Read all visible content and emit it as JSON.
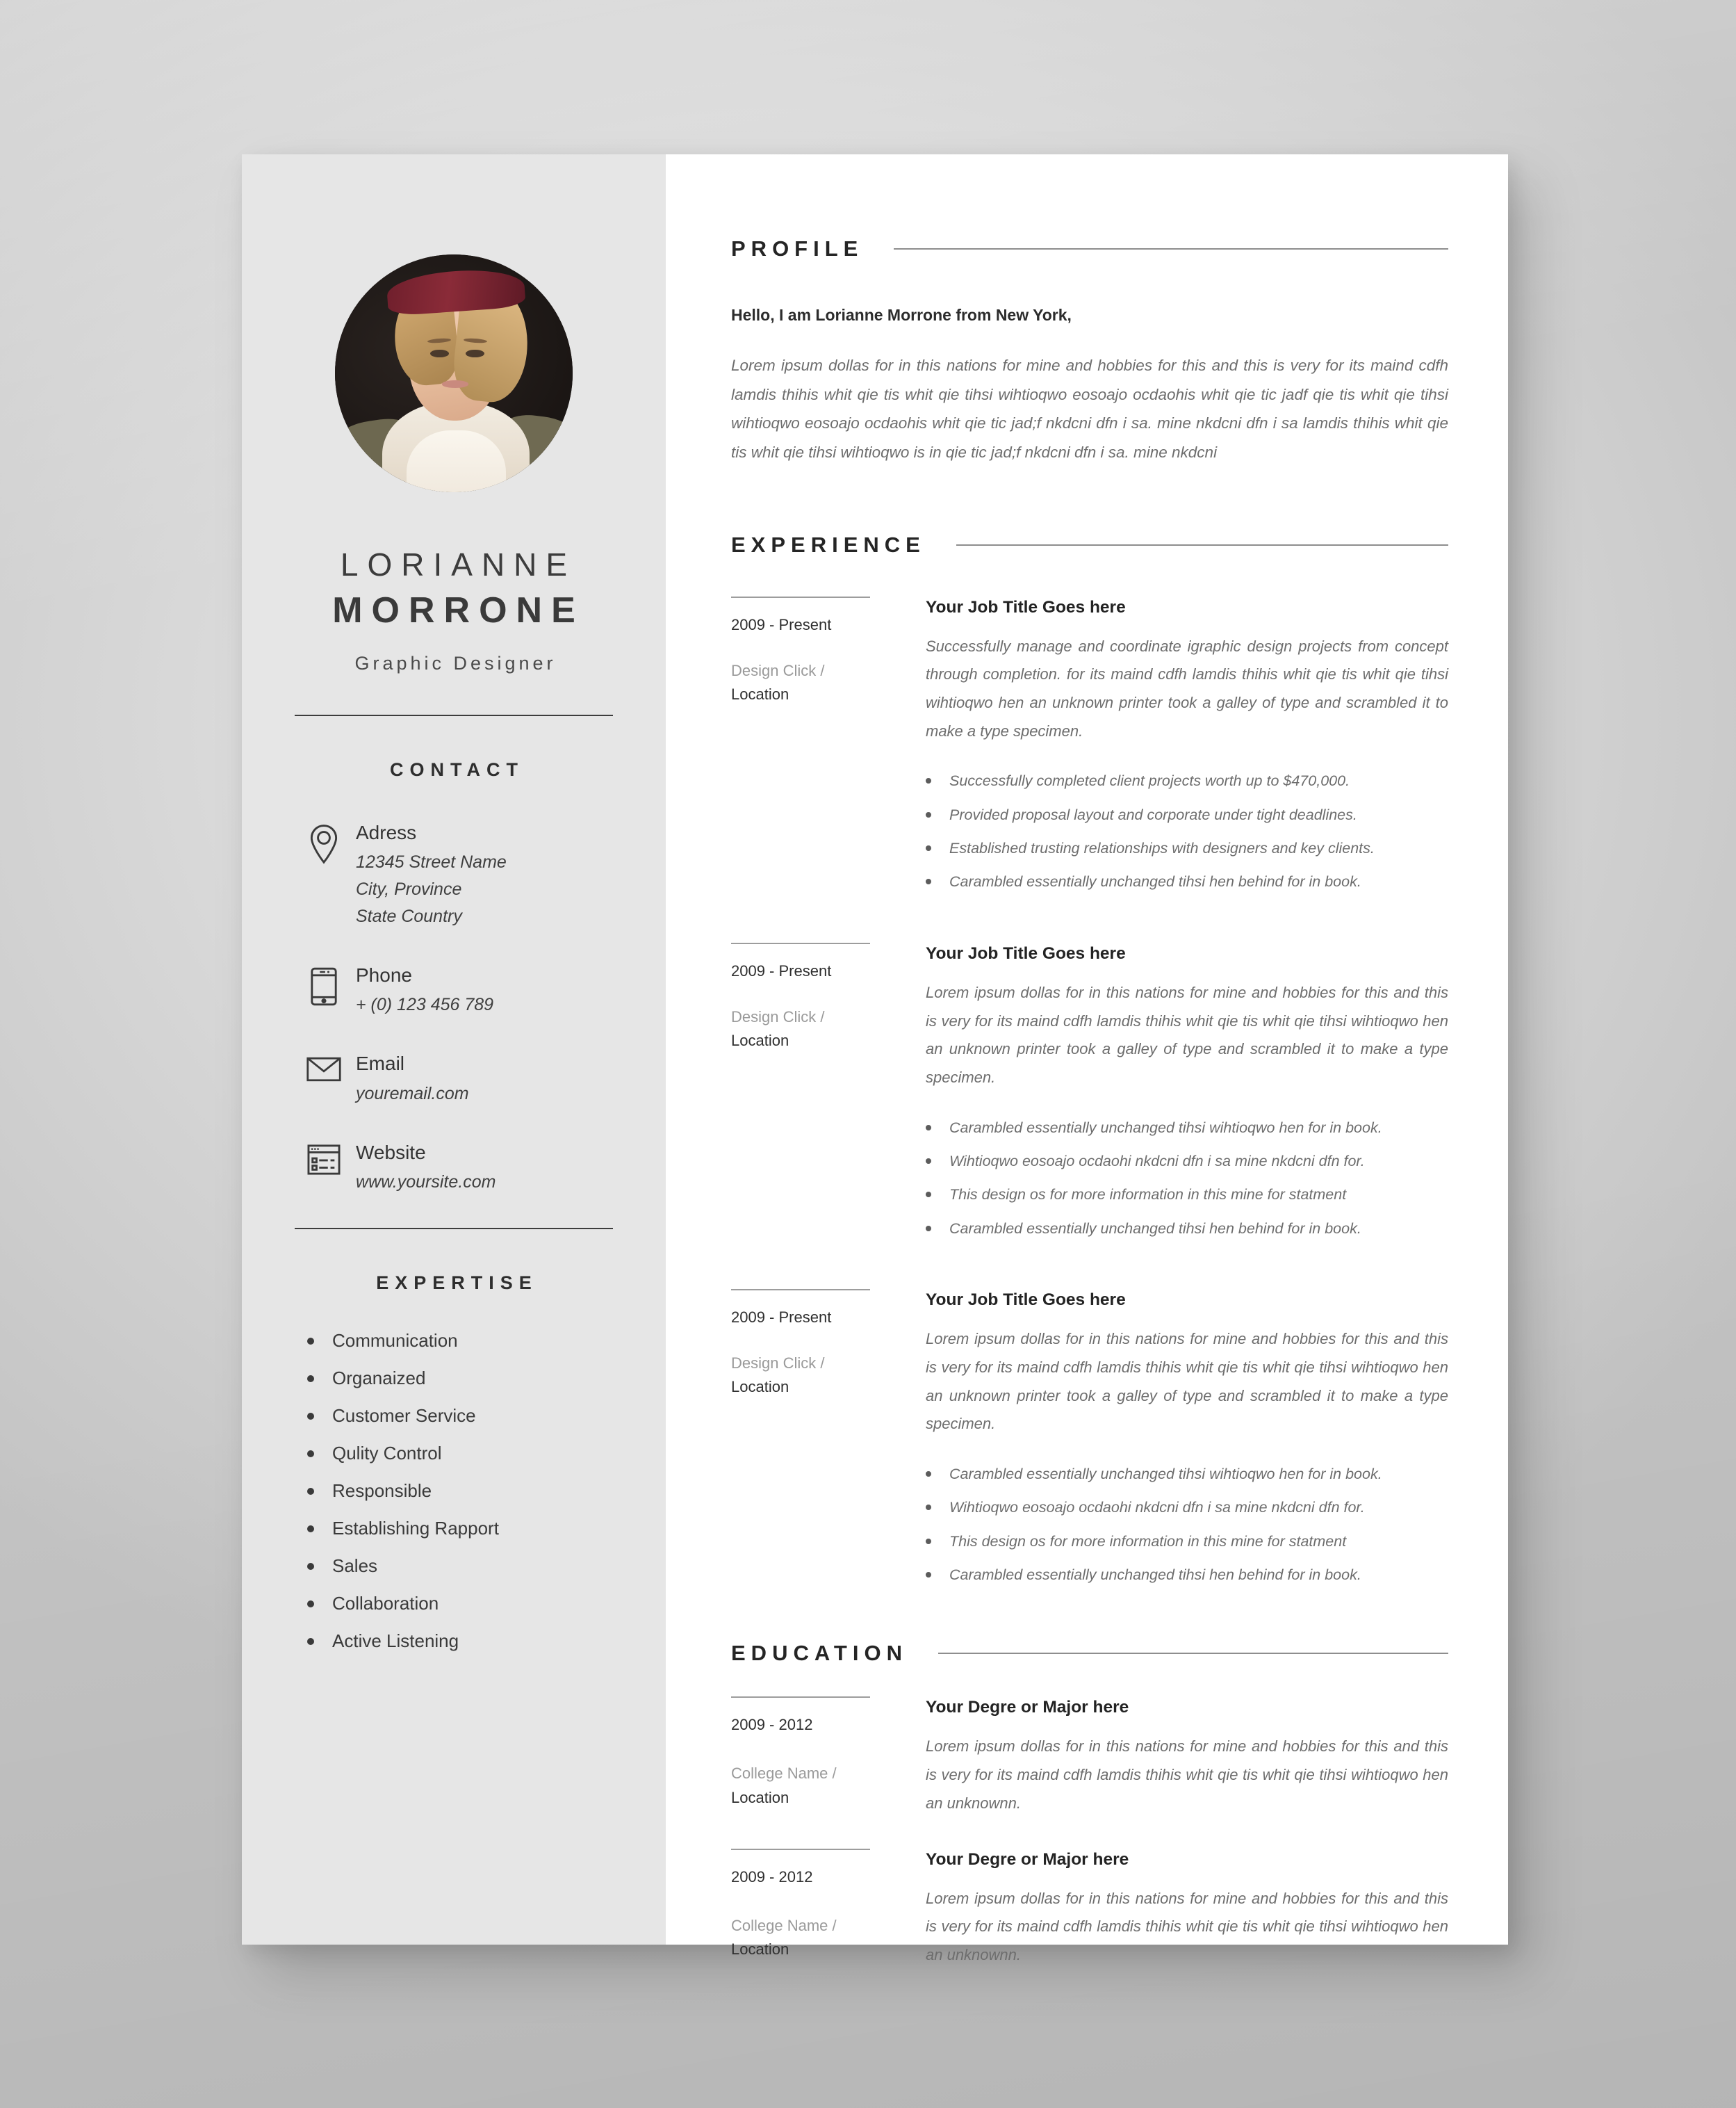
{
  "person": {
    "first_name": "LORIANNE",
    "last_name": "MORRONE",
    "role": "Graphic Designer"
  },
  "sidebar": {
    "contact_heading": "CONTACT",
    "contact": [
      {
        "icon": "location-pin-icon",
        "label": "Adress",
        "lines": [
          "12345 Street Name",
          "City, Province",
          "State Country"
        ]
      },
      {
        "icon": "smartphone-icon",
        "label": "Phone",
        "lines": [
          "+ (0) 123 456 789"
        ]
      },
      {
        "icon": "envelope-icon",
        "label": "Email",
        "lines": [
          "youremail.com"
        ]
      },
      {
        "icon": "browser-window-icon",
        "label": "Website",
        "lines": [
          "www.yoursite.com"
        ]
      }
    ],
    "expertise_heading": "EXPERTISE",
    "expertise": [
      "Communication",
      "Organaized",
      "Customer Service",
      "Qulity Control",
      "Responsible",
      "Establishing Rapport",
      "Sales",
      "Collaboration",
      "Active Listening"
    ]
  },
  "main": {
    "profile": {
      "heading": "PROFILE",
      "intro": "Hello, I am Lorianne Morrone from New York,",
      "body": "Lorem ipsum dollas for in this nations for mine and hobbies for this and this is very for its maind cdfh lamdis thihis whit qie tis whit qie tihsi wihtioqwo eosoajo ocdaohis whit qie tic jadf qie tis whit qie tihsi wihtioqwo eosoajo ocdaohis whit qie tic jad;f nkdcni dfn i sa. mine  nkdcni dfn i sa lamdis thihis whit qie tis whit qie tihsi wihtioqwo is in qie tic jad;f nkdcni dfn i sa. mine  nkdcni"
    },
    "experience": {
      "heading": "EXPERIENCE",
      "entries": [
        {
          "date": "2009 - Present",
          "org": "Design Click /",
          "location": "Location",
          "title": "Your Job Title Goes here",
          "desc": "Successfully manage and coordinate igraphic design projects  from concept through completion. for its maind cdfh lamdis thihis whit qie tis whit qie tihsi wihtioqwo hen an unknown printer took a galley of type and scrambled it to make a type specimen.",
          "bullets": [
            "Successfully completed client projects worth up to $470,000.",
            "Provided proposal layout and corporate under tight deadlines.",
            "Established trusting relationships with designers and key clients.",
            "Carambled essentially unchanged tihsi hen behind for in book."
          ]
        },
        {
          "date": "2009 - Present",
          "org": "Design Click /",
          "location": "Location",
          "title": "Your Job Title Goes here",
          "desc": "Lorem ipsum dollas for in this nations for mine and hobbies for this and this is very for its maind cdfh lamdis thihis whit qie tis whit qie tihsi wihtioqwo hen an unknown printer took a galley of type and scrambled it to make a type specimen.",
          "bullets": [
            "Carambled essentially unchanged tihsi wihtioqwo hen for in book.",
            "Wihtioqwo eosoajo ocdaohi nkdcni dfn i sa mine  nkdcni dfn for.",
            "This design os for more information in this mine for statment",
            "Carambled essentially unchanged tihsi hen behind for in book."
          ]
        },
        {
          "date": "2009 - Present",
          "org": "Design Click /",
          "location": "Location",
          "title": "Your Job Title Goes here",
          "desc": "Lorem ipsum dollas for in this nations for mine and hobbies for this and this is very for its maind cdfh lamdis thihis whit qie tis whit qie tihsi wihtioqwo hen an unknown printer took a galley of type and scrambled it to make a type specimen.",
          "bullets": [
            "Carambled essentially unchanged tihsi wihtioqwo hen for in book.",
            "Wihtioqwo eosoajo ocdaohi nkdcni dfn i sa mine  nkdcni dfn for.",
            "This design os for more information in this mine for statment",
            "Carambled essentially unchanged tihsi hen behind for in book."
          ]
        }
      ]
    },
    "education": {
      "heading": "EDUCATION",
      "entries": [
        {
          "date": "2009 - 2012",
          "org": "College Name /",
          "location": "Location",
          "title": "Your Degre or Major here",
          "desc": "Lorem ipsum dollas for in this nations for mine and hobbies for this and this is very for its maind cdfh lamdis thihis whit qie tis whit qie tihsi wihtioqwo hen an unknownn."
        },
        {
          "date": "2009 - 2012",
          "org": "College Name /",
          "location": "Location",
          "title": "Your Degre or Major here",
          "desc": "Lorem ipsum dollas for in this nations for mine and hobbies for this and this is very for its maind cdfh lamdis thihis whit qie tis whit qie tihsi wihtioqwo hen an unknownn."
        }
      ]
    }
  },
  "colors": {
    "sidebar_bg": "#e6e6e6",
    "page_bg": "#ffffff",
    "backdrop": "#d2d2d2",
    "text_dark": "#2e2e2e",
    "text_muted": "#6d6d6d",
    "rule": "#8e8e8e"
  }
}
